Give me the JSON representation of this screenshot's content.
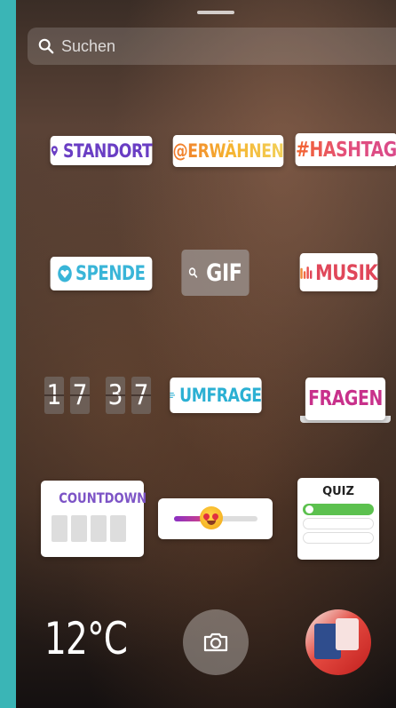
{
  "search": {
    "placeholder": "Suchen"
  },
  "stickers": {
    "location": "STANDORT",
    "mention": "@ERWÄHNEN",
    "hashtag": "#HASHTAG",
    "donation": "SPENDE",
    "gif": "GIF",
    "music": "MUSIK",
    "time_digits": [
      "1",
      "7",
      "3",
      "7"
    ],
    "poll": "UMFRAGE",
    "questions": "FRAGEN",
    "countdown": "COUNTDOWN",
    "emoji_slider_level": 0.45,
    "quiz": "QUIZ"
  },
  "weather": {
    "temperature": "12°C"
  },
  "colors": {
    "location": "#6a3ec4",
    "donation": "#39b5d8",
    "music": "#e0475a",
    "questions": "#c8318b",
    "countdown": "#7d54c6",
    "quiz_correct": "#5cc14f"
  },
  "icons": {
    "search": "search-icon",
    "location": "location-pin-icon",
    "donation": "heart-icon",
    "gif": "search-icon",
    "music": "equalizer-icon",
    "poll": "poll-lines-icon",
    "camera": "camera-icon"
  }
}
